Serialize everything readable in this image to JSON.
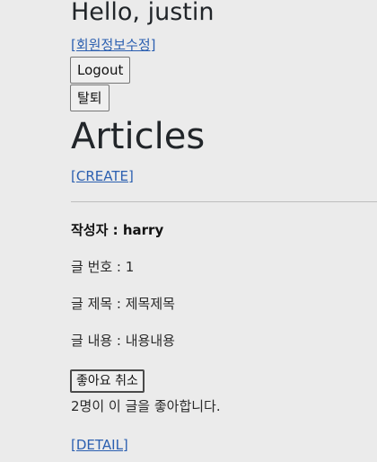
{
  "header": {
    "greeting": "Hello, justin",
    "edit_profile_link": "[회원정보수정]",
    "logout_button": "Logout",
    "withdraw_button": "탈퇴"
  },
  "main": {
    "title": "Articles",
    "create_link": "[CREATE]"
  },
  "article": {
    "author_label": "작성자 : harry",
    "number_label": "글 번호 : 1",
    "title_label": "글 제목 : 제목제목",
    "content_label": "글 내용 : 내용내용",
    "unlike_button": "좋아요 취소",
    "likes_text": "2명이 이 글을 좋아합니다.",
    "detail_link": "[DETAIL]"
  }
}
